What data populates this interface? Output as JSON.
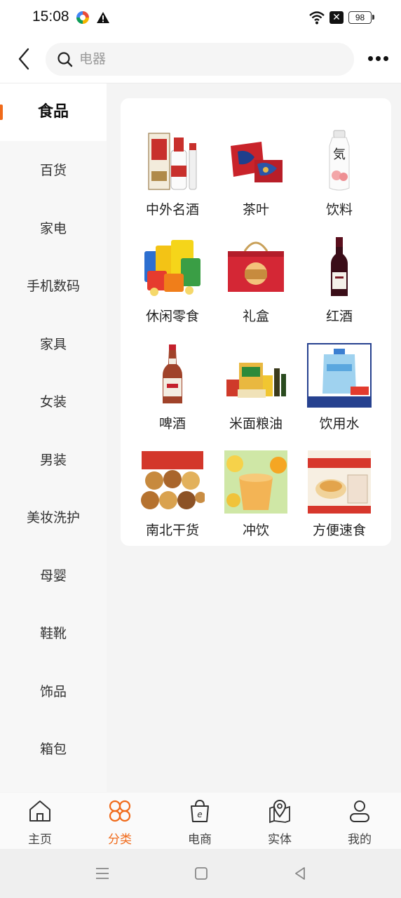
{
  "status_bar": {
    "time": "15:08",
    "battery": "98"
  },
  "search": {
    "placeholder": "电器"
  },
  "sidebar": {
    "items": [
      {
        "label": "食品"
      },
      {
        "label": "百货"
      },
      {
        "label": "家电"
      },
      {
        "label": "手机数码"
      },
      {
        "label": "家具"
      },
      {
        "label": "女装"
      },
      {
        "label": "男装"
      },
      {
        "label": "美妆洗护"
      },
      {
        "label": "母婴"
      },
      {
        "label": "鞋靴"
      },
      {
        "label": "饰品"
      },
      {
        "label": "箱包"
      }
    ]
  },
  "categories": [
    {
      "label": "中外名酒",
      "icon": "liquor-image"
    },
    {
      "label": "茶叶",
      "icon": "tea-gift-box-image"
    },
    {
      "label": "饮料",
      "icon": "beverage-bottle-image"
    },
    {
      "label": "休闲零食",
      "icon": "snacks-image"
    },
    {
      "label": "礼盒",
      "icon": "gift-box-image"
    },
    {
      "label": "红酒",
      "icon": "red-wine-image"
    },
    {
      "label": "啤酒",
      "icon": "beer-bottle-image"
    },
    {
      "label": "米面粮油",
      "icon": "grain-oil-image"
    },
    {
      "label": "饮用水",
      "icon": "water-jug-image"
    },
    {
      "label": "南北干货",
      "icon": "dried-goods-image"
    },
    {
      "label": "冲饮",
      "icon": "brewed-drink-image"
    },
    {
      "label": "方便速食",
      "icon": "instant-food-image"
    }
  ],
  "bottom_nav": {
    "items": [
      {
        "label": "主页",
        "icon": "home-icon"
      },
      {
        "label": "分类",
        "icon": "category-icon"
      },
      {
        "label": "电商",
        "icon": "shopping-bag-icon"
      },
      {
        "label": "实体",
        "icon": "map-pin-icon"
      },
      {
        "label": "我的",
        "icon": "profile-icon"
      }
    ]
  },
  "colors": {
    "accent": "#f06a1a",
    "background": "#f4f4f4"
  }
}
